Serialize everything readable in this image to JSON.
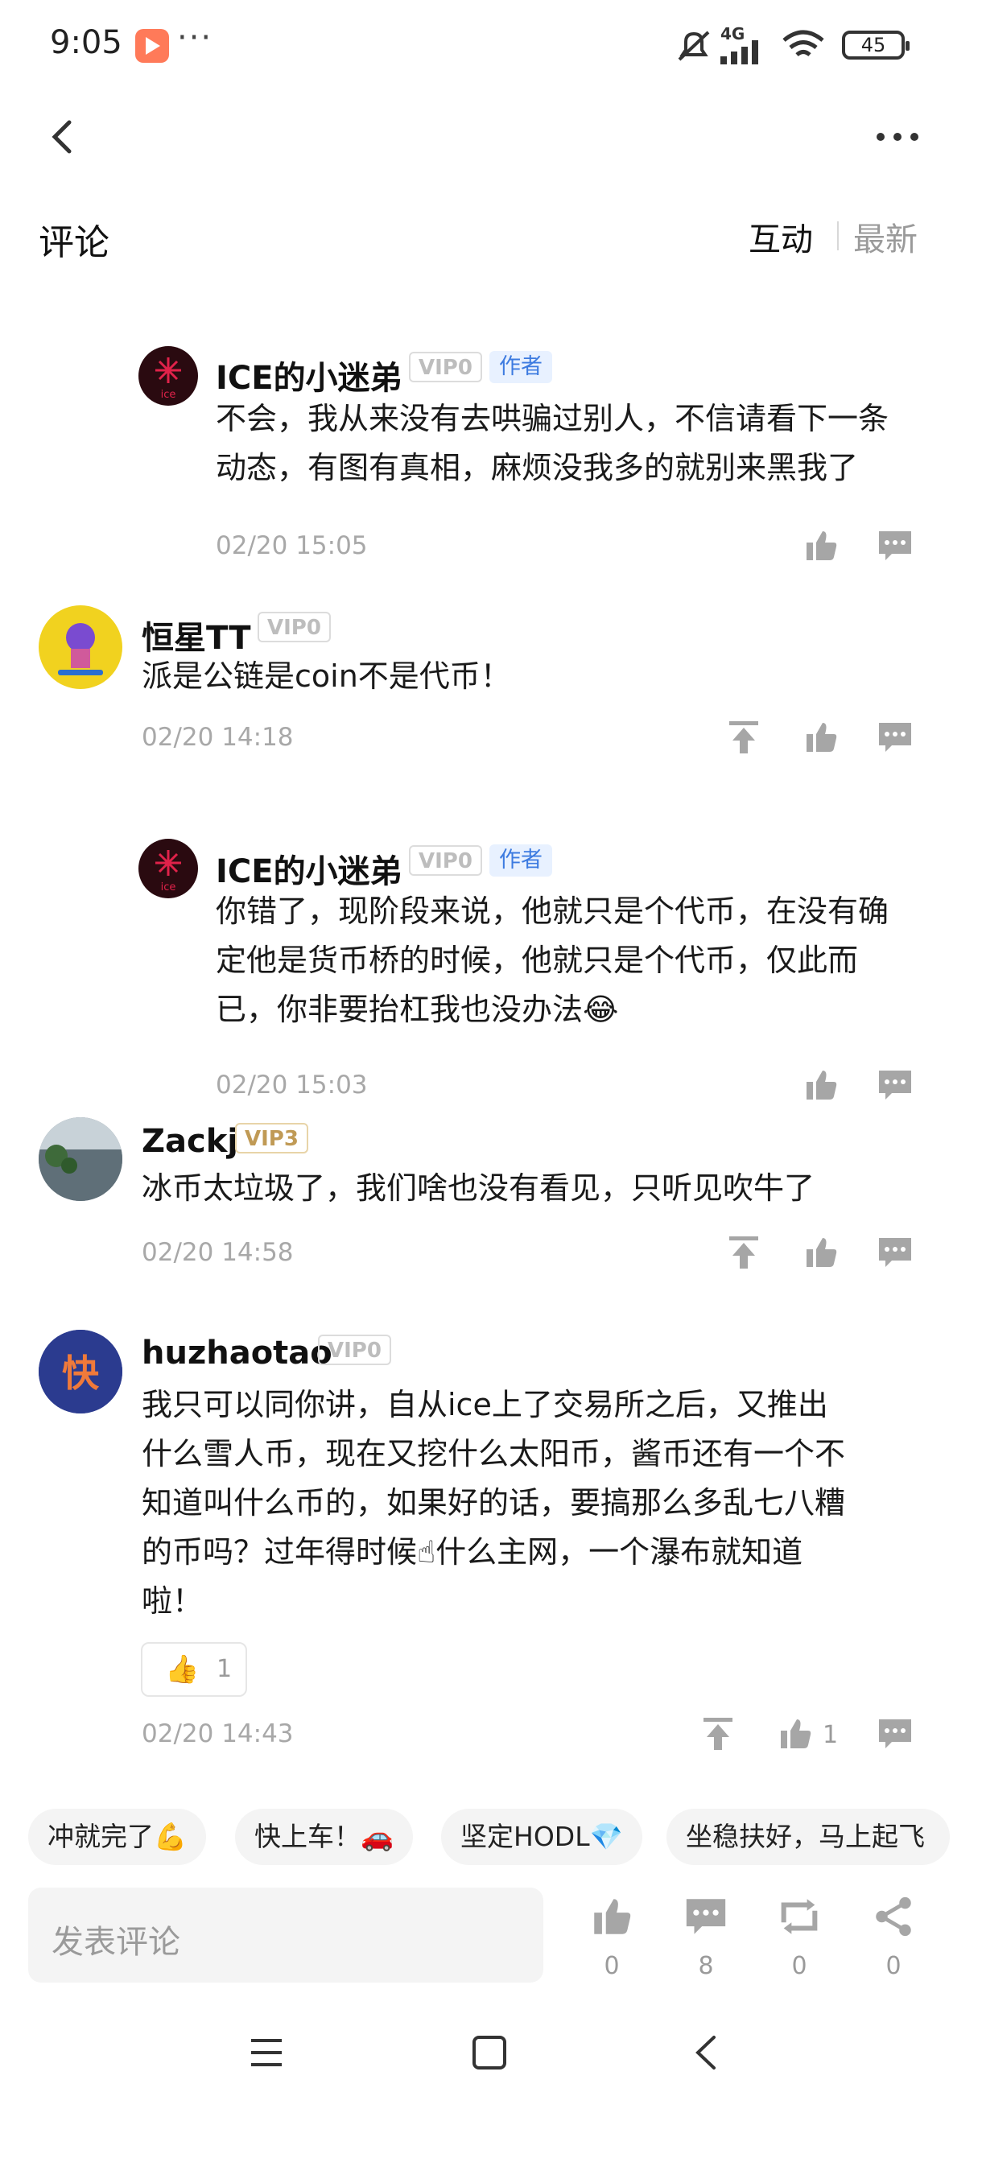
{
  "status_bar": {
    "time": "9:05",
    "more": "···",
    "battery": "45",
    "signal": "4G"
  },
  "header": {
    "title": "评论",
    "tab_interact": "互动",
    "tab_latest": "最新"
  },
  "comments": [
    {
      "user": "ICE的小迷弟",
      "vip": "VIP0",
      "badge": "作者",
      "text": [
        "不会，我从来没有去哄骗过别人，不信请看下一条",
        "动态，有图有真相，麻烦没我多的就别来黑我了"
      ],
      "date": "02/20 15:05"
    },
    {
      "user": "恒星TT",
      "vip": "VIP0",
      "text": [
        "派是公链是coin不是代币！"
      ],
      "date": "02/20 14:18"
    },
    {
      "user": "ICE的小迷弟",
      "vip": "VIP0",
      "badge": "作者",
      "text": [
        "你错了，现阶段来说，他就只是个代币，在没有确",
        "定他是货币桥的时候，他就只是个代币，仅此而",
        "已，你非要抬杠我也没办法😂"
      ],
      "date": "02/20 15:03"
    },
    {
      "user": "Zackj",
      "vip": "VIP3",
      "text": [
        "冰币太垃圾了，我们啥也没有看见，只听见吹牛了"
      ],
      "date": "02/20 14:58"
    },
    {
      "user": "huzhaotao",
      "vip": "VIP0",
      "text": [
        "我只可以同你讲，自从ice上了交易所之后，又推出",
        "什么雪人币，现在又挖什么太阳币，酱币还有一个不",
        "知道叫什么币的，如果好的话，要搞那么多乱七八糟",
        "的币吗？过年得时候☝什么主网，一个瀑布就知道",
        "啦！"
      ],
      "reaction": "👍",
      "reaction_count": "1",
      "like_count": "1",
      "date": "02/20 14:43"
    }
  ],
  "avatars": {
    "ice_label": "ice",
    "huzhao_text": "快"
  },
  "quick_replies": [
    "冲就完了💪",
    "快上车！🚗",
    "坚定HODL💎",
    "坐稳扶好，马上起飞"
  ],
  "bottom_bar": {
    "placeholder": "发表评论",
    "likes": "0",
    "comments": "8",
    "shares": "0",
    "forwards": "0"
  },
  "colors": {
    "accent": "#3d7be0",
    "icon_gray": "#a6a6a6"
  }
}
